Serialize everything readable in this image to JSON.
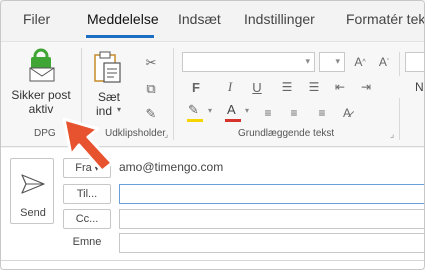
{
  "tabs": [
    "Filer",
    "Meddelelse",
    "Indsæt",
    "Indstillinger",
    "Formatér tekst"
  ],
  "active_tab": "Meddelelse",
  "ribbon": {
    "dpg": {
      "button_label_line1": "Sikker post",
      "button_label_line2": "aktiv",
      "group_label": "DPG"
    },
    "clipboard": {
      "paste_label_line1": "Sæt",
      "paste_label_line2": "ind",
      "group_label": "Udklipsholder"
    },
    "basic_text": {
      "group_label": "Grundlæggende tekst",
      "partial_label": "N"
    }
  },
  "compose": {
    "send_label": "Send",
    "from_label": "Fra",
    "from_address": "amo@timengo.com",
    "to_label": "Til...",
    "cc_label": "Cc...",
    "subject_label": "Emne"
  },
  "colors": {
    "accent": "#1a6fc2",
    "dpg_lock": "#3fa535",
    "arrow": "#e8532f",
    "text_highlight": "#f5d400",
    "font_color": "#d6332a"
  }
}
